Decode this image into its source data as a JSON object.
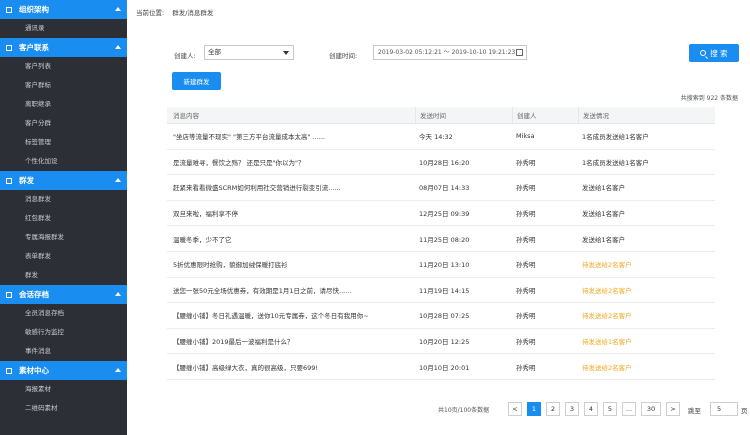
{
  "sidebar": {
    "sections": [
      {
        "title": "组织架构",
        "items": [
          "通讯录"
        ]
      },
      {
        "title": "客户联系",
        "items": [
          "客户列表",
          "客户群标",
          "离职继承",
          "客户分群",
          "标签管理",
          "个性化加设"
        ]
      },
      {
        "title": "群发",
        "items": [
          "消息群发",
          "红包群发",
          "专属海报群发",
          "表单群发",
          "群发"
        ]
      },
      {
        "title": "会话存档",
        "items": [
          "全员消息存档",
          "敏感行为监控",
          "事件消息"
        ]
      },
      {
        "title": "素材中心",
        "items": [
          "海报素材",
          "二维码素材"
        ]
      }
    ]
  },
  "breadcrumb": {
    "prefix": "当前位置:",
    "path": "群发/消息群发"
  },
  "filters": {
    "creator_label": "创建人:",
    "creator_value": "全部",
    "time_label": "创建时间:",
    "time_value": "2019-03-02 05:12:21 ～ 2019-10-10 19:21:23"
  },
  "buttons": {
    "search": "搜 索",
    "new": "新建群发"
  },
  "total_text": "共搜索到 922 条数据",
  "table": {
    "headers": [
      "消息内容",
      "发送时间",
      "创建人",
      "发送情况"
    ],
    "rows": [
      {
        "content": "\"坐店等流量不现实\" \"第三方平台流量成本太高\" ......",
        "time": "今天 14:32",
        "creator": "Miksa",
        "status": "1名成员发送给1名客户",
        "pending": false
      },
      {
        "content": "是流量难寻，餐饮之殇？ 还是只是\"你以为\"？",
        "time": "10月28日 16:20",
        "creator": "孙秀明",
        "status": "1名成员发送给1名客户",
        "pending": false
      },
      {
        "content": "赶紧来看看微盛SCRM如何利用社交营销进行裂变引流......",
        "time": "08月07日 14:33",
        "creator": "孙秀明",
        "status": "发送给1名客户",
        "pending": false
      },
      {
        "content": "双旦来啦，福利享不停",
        "time": "12月25日 09:39",
        "creator": "孙秀明",
        "status": "发送给1名客户",
        "pending": false
      },
      {
        "content": "温暖冬季，少不了它",
        "time": "11月25日 08:20",
        "creator": "孙秀明",
        "status": "发送给1名客户",
        "pending": false
      },
      {
        "content": "5折优惠限时抢购，貌御加绒保暖打底衫",
        "time": "11月20日 13:10",
        "creator": "孙秀明",
        "status": "待发送给2名客户",
        "pending": true
      },
      {
        "content": "送您一张50元全场优惠券，有效期是1月1日之前，请尽快......",
        "time": "11月19日 14:15",
        "creator": "孙秀明",
        "status": "待发送给2名客户",
        "pending": true
      },
      {
        "content": "【腰缠小铺】冬日礼遇温暖，送你10元专属券，这个冬日有我用你~",
        "time": "10月28日 07:25",
        "creator": "孙秀明",
        "status": "待发送给2名客户",
        "pending": true
      },
      {
        "content": "【腰缠小铺】2019最后一波福利是什么？",
        "time": "10月20日 12:25",
        "creator": "孙秀明",
        "status": "待发送给1名客户",
        "pending": true
      },
      {
        "content": "【腰缠小铺】高级绿大衣，真的很高级，只要699!",
        "time": "10月10日 20:01",
        "creator": "孙秀明",
        "status": "待发送给2名客户",
        "pending": true
      }
    ]
  },
  "pagination": {
    "summary": "共10页/100条数据",
    "prev": "<",
    "pages": [
      "1",
      "2",
      "3",
      "4",
      "5",
      "...",
      "30"
    ],
    "next": ">",
    "jump_label": "跳至",
    "jump_value": "5",
    "jump_unit": "页",
    "current": "1"
  },
  "colors": {
    "accent": "#1a8df0",
    "sidebar_bg": "#2c2f36",
    "pending": "#f5a623"
  }
}
